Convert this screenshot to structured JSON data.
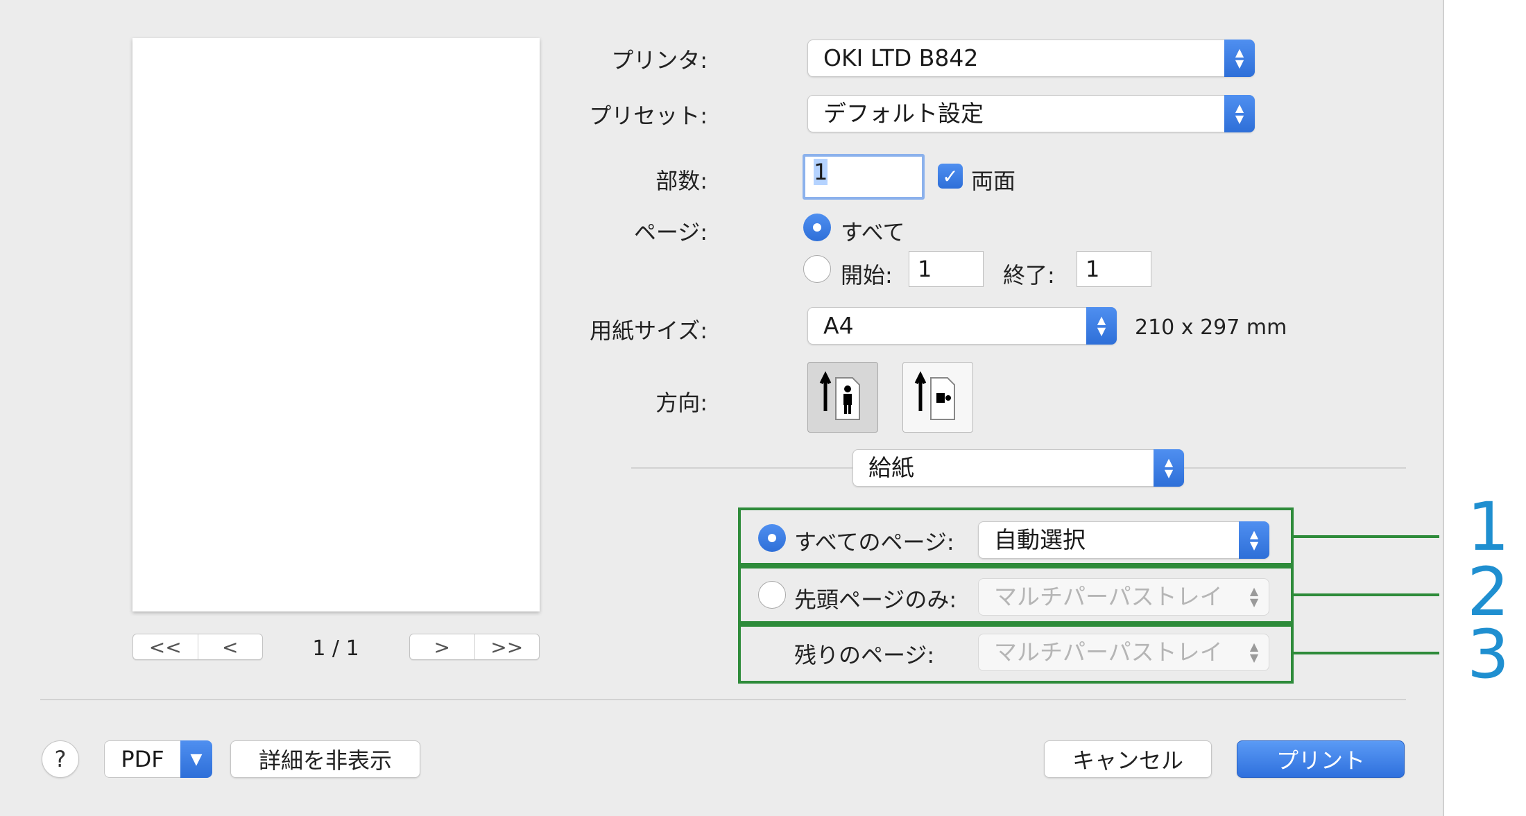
{
  "printer": {
    "label": "プリンタ:",
    "value": "OKI LTD B842"
  },
  "preset": {
    "label": "プリセット:",
    "value": "デフォルト設定"
  },
  "copies": {
    "label": "部数:",
    "value": "1",
    "duplex_label": "両面",
    "duplex_checked": true
  },
  "pages": {
    "label": "ページ:",
    "all_label": "すべて",
    "range_from_label": "開始:",
    "range_from_value": "1",
    "range_to_label": "終了:",
    "range_to_value": "1",
    "selected": "all"
  },
  "paper_size": {
    "label": "用紙サイズ:",
    "value": "A4",
    "dimensions": "210 x 297 mm"
  },
  "orientation": {
    "label": "方向:",
    "selected": "portrait"
  },
  "section_menu": {
    "value": "給紙"
  },
  "paper_feed": {
    "all_pages_label": "すべてのページ:",
    "all_pages_value": "自動選択",
    "first_page_label": "先頭ページのみ:",
    "first_page_value": "マルチパーパストレイ",
    "remaining_label": "残りのページ:",
    "remaining_value": "マルチパーパストレイ",
    "selected": "all_pages"
  },
  "callouts": [
    "1",
    "2",
    "3"
  ],
  "preview": {
    "page_indicator": "1 / 1",
    "first_btn": "<<",
    "prev_btn": "<",
    "next_btn": ">",
    "last_btn": ">>"
  },
  "footer": {
    "help": "?",
    "pdf_label": "PDF",
    "hide_details_label": "詳細を非表示",
    "cancel_label": "キャンセル",
    "print_label": "プリント"
  },
  "colors": {
    "accent": "#2e6fd8",
    "callout_box": "#2e8b3a",
    "callout_number": "#1f8fd0"
  }
}
